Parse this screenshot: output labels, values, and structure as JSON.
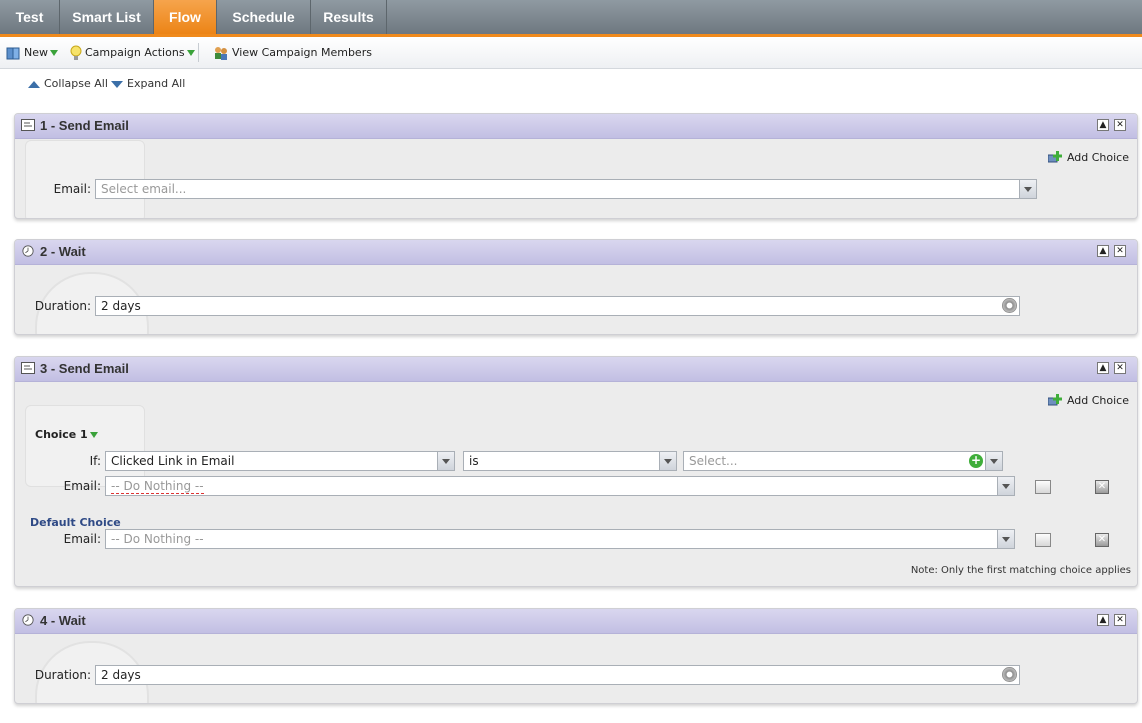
{
  "tabs": [
    {
      "label": "Test",
      "active": false
    },
    {
      "label": "Smart List",
      "active": false
    },
    {
      "label": "Flow",
      "active": true
    },
    {
      "label": "Schedule",
      "active": false
    },
    {
      "label": "Results",
      "active": false
    }
  ],
  "toolbar": {
    "new_label": "New",
    "campaign_actions_label": "Campaign Actions",
    "view_members_label": "View Campaign Members"
  },
  "collapse_all": "Collapse All",
  "expand_all": "Expand All",
  "colors": {
    "accent": "#ec8416",
    "panel_header": "#c2bfe3",
    "link_blue": "#2f4a86"
  },
  "steps": [
    {
      "title": "1 - Send Email",
      "icon": "email-icon",
      "add_choice": "Add Choice",
      "email_label": "Email:",
      "email_placeholder": "Select email..."
    },
    {
      "title": "2 - Wait",
      "icon": "clock-icon",
      "duration_label": "Duration:",
      "duration_value": "2 days"
    },
    {
      "title": "3 - Send Email",
      "icon": "email-icon",
      "add_choice": "Add Choice",
      "choice_label": "Choice 1",
      "if_label": "If:",
      "if_condition": "Clicked Link in Email",
      "operator": "is",
      "value_placeholder": "Select...",
      "email_label": "Email:",
      "choice_email_value": "-- Do Nothing --",
      "default_choice_label": "Default Choice",
      "default_email_label": "Email:",
      "default_email_value": "-- Do Nothing --",
      "note": "Note: Only the first matching choice applies"
    },
    {
      "title": "4 - Wait",
      "icon": "clock-icon",
      "duration_label": "Duration:",
      "duration_value": "2 days"
    }
  ]
}
